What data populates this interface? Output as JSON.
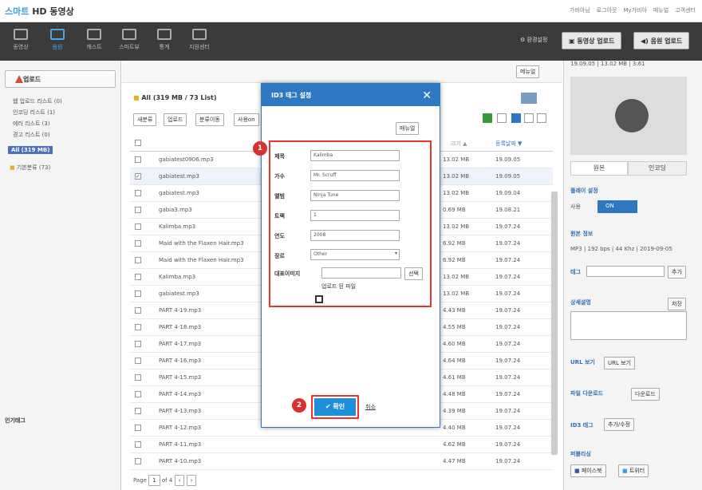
{
  "top": {
    "logo_a": "스마트",
    "logo_b": "HD 동영상",
    "links": [
      "가비아님",
      "로그아웃",
      "My가비아",
      "매뉴얼",
      "고객센터"
    ]
  },
  "nav": {
    "items": [
      "동영상",
      "음원",
      "캐스트",
      "스마트뷰",
      "통계",
      "지원센터"
    ],
    "active": "음원",
    "settings": "환경설정",
    "upload_video": "동영상 업로드",
    "upload_audio": "음원 업로드"
  },
  "sidebar": {
    "upload": "업로드",
    "lists": [
      "웹 업로드 리스트 (0)",
      "인코딩 리스트 (1)",
      "에러 리스트 (3)",
      "경고 리스트 (0)"
    ],
    "all": "All (319 MB)",
    "folder": "기본분류 (73)",
    "popular": "인기태그"
  },
  "main": {
    "menu": "메뉴얼",
    "title": "All (319 MB / 73 List)",
    "toolbar": [
      "새분류",
      "업로드",
      "분류이동",
      "사용on"
    ],
    "col_size": "크기 ▲",
    "col_date": "등록날짜 ▼",
    "rows": [
      {
        "name": "gabiatest0906.mp3",
        "size": "13.02 MB",
        "date": "19.09.05",
        "checked": false
      },
      {
        "name": "gabiatest.mp3",
        "size": "13.02 MB",
        "date": "19.09.05",
        "checked": true
      },
      {
        "name": "gabiatest.mp3",
        "size": "13.02 MB",
        "date": "19.09.04",
        "checked": false
      },
      {
        "name": "gabia3.mp3",
        "size": "0.69 MB",
        "date": "19.08.21",
        "checked": false
      },
      {
        "name": "Kalimba.mp3",
        "size": "13.02 MB",
        "date": "19.07.24",
        "checked": false
      },
      {
        "name": "Maid with the Flaxen Hair.mp3",
        "size": "6.92 MB",
        "date": "19.07.24",
        "checked": false
      },
      {
        "name": "Maid with the Flaxen Hair.mp3",
        "size": "6.92 MB",
        "date": "19.07.24",
        "checked": false
      },
      {
        "name": "Kalimba.mp3",
        "size": "13.02 MB",
        "date": "19.07.24",
        "checked": false
      },
      {
        "name": "gabiatest.mp3",
        "size": "13.02 MB",
        "date": "19.07.24",
        "checked": false
      },
      {
        "name": "PART 4-19.mp3",
        "size": "4.43 MB",
        "date": "19.07.24",
        "checked": false
      },
      {
        "name": "PART 4-18.mp3",
        "size": "4.55 MB",
        "date": "19.07.24",
        "checked": false
      },
      {
        "name": "PART 4-17.mp3",
        "size": "4.60 MB",
        "date": "19.07.24",
        "checked": false
      },
      {
        "name": "PART 4-16.mp3",
        "size": "4.64 MB",
        "date": "19.07.24",
        "checked": false
      },
      {
        "name": "PART 4-15.mp3",
        "size": "4.61 MB",
        "date": "19.07.24",
        "checked": false
      },
      {
        "name": "PART 4-14.mp3",
        "size": "4.48 MB",
        "date": "19.07.24",
        "checked": false
      },
      {
        "name": "PART 4-13.mp3",
        "size": "4.39 MB",
        "date": "19.07.24",
        "checked": false
      },
      {
        "name": "PART 4-12.mp3",
        "size": "4.40 MB",
        "date": "19.07.24",
        "checked": false
      },
      {
        "name": "PART 4-11.mp3",
        "size": "4.62 MB",
        "date": "19.07.24",
        "checked": false
      },
      {
        "name": "PART 4-10.mp3",
        "size": "4.47 MB",
        "date": "19.07.24",
        "checked": false
      }
    ],
    "page_label": "Page",
    "page_num": "1",
    "page_of": "of 4"
  },
  "right": {
    "fileinfo": "19.09.05 | 13.02 MB | 3:61",
    "tab_a": "원본",
    "tab_b": "인코딩",
    "play_setting": "플레이 설정",
    "use": "사용",
    "on": "ON",
    "src_info": "원본 정보",
    "src_detail": "MP3 | 192 bps | 44 Khz | 2019-09-05",
    "tag": "태그",
    "add": "추가",
    "detail": "상세설명",
    "save": "저장",
    "url_view": "URL 보기",
    "url_btn": "URL 보기",
    "download": "파일 다운로드",
    "download_btn": "다운로드",
    "id3": "ID3 태그",
    "id3_btn": "추가/수정",
    "publish": "퍼블리싱",
    "facebook": "페이스북",
    "twitter": "트위터"
  },
  "modal": {
    "title": "ID3 태그 설정",
    "menu": "매뉴얼",
    "badge1": "1",
    "badge2": "2",
    "fields": [
      {
        "label": "제목",
        "value": "Kalimba"
      },
      {
        "label": "가수",
        "value": "Mr. Scruff"
      },
      {
        "label": "앨범",
        "value": "Ninja Tune"
      },
      {
        "label": "트랙",
        "value": "1"
      },
      {
        "label": "연도",
        "value": "2008"
      }
    ],
    "genre_label": "장르",
    "genre_value": "Other",
    "cover_label": "대표이미지",
    "cover_btn": "선택",
    "uploaded_file": "업로드 된 파일",
    "ok": "확인",
    "cancel": "취소"
  }
}
